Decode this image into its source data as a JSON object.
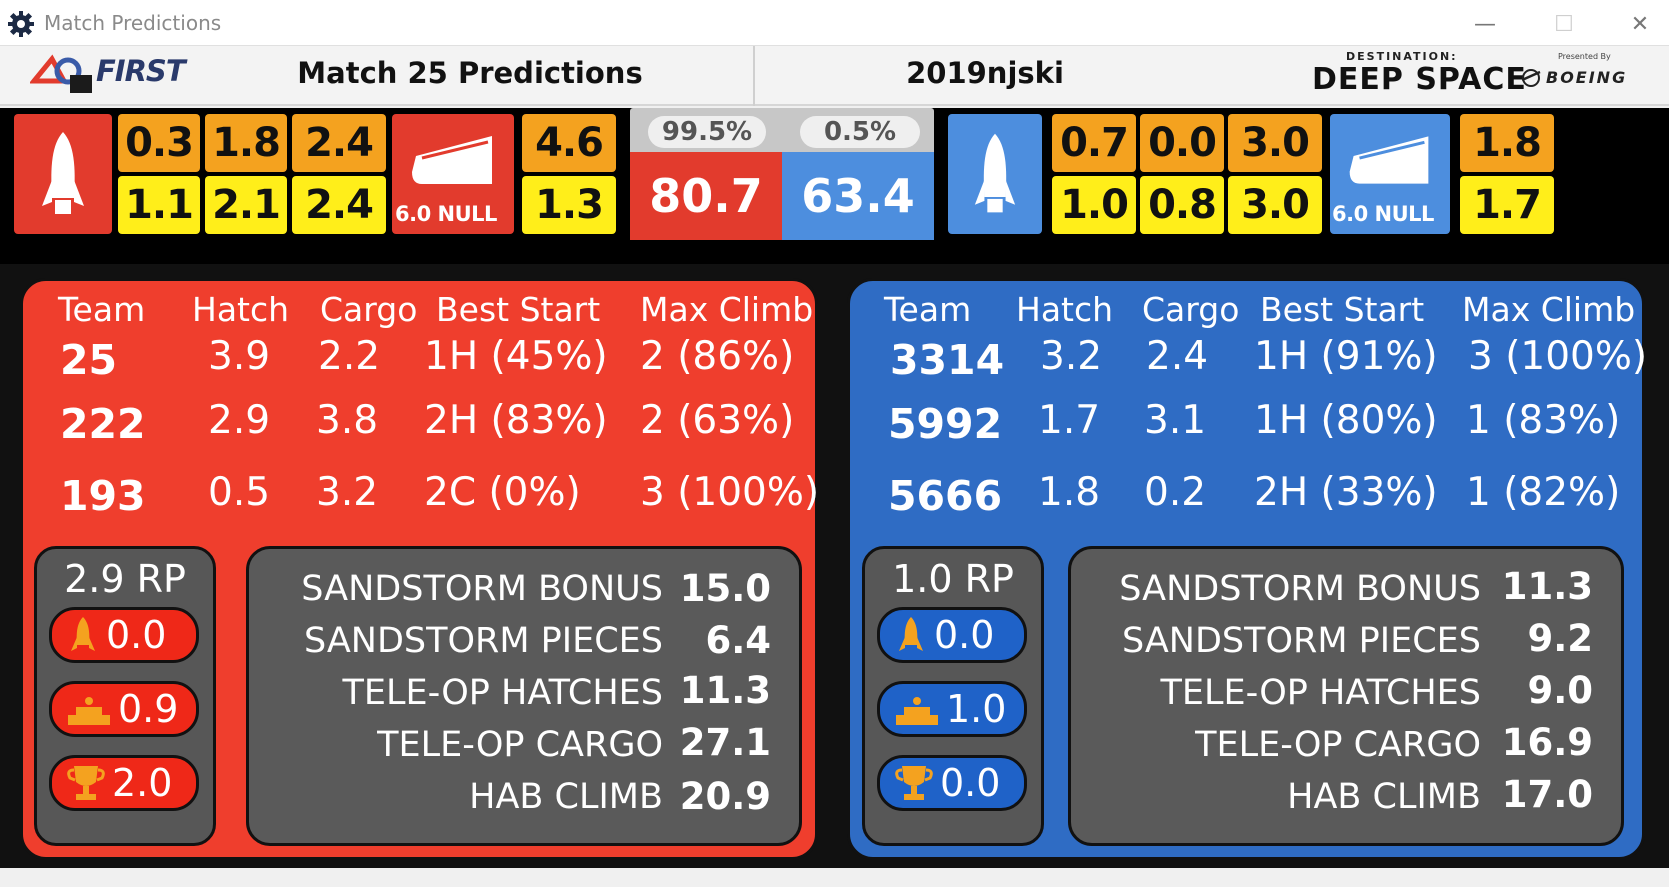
{
  "window": {
    "title": "Match Predictions"
  },
  "header": {
    "first_logo": "FIRST",
    "match_title": "Match 25 Predictions",
    "event_code": "2019njski",
    "game_logo_top": "DESTINATION:",
    "game_logo_main": "DEEP SPACE",
    "sponsor_small": "Presented By",
    "sponsor": "BOEING"
  },
  "strip": {
    "red": {
      "rocket_top": [
        "0.3",
        "1.8",
        "2.4"
      ],
      "rocket_bottom": [
        "1.1",
        "2.1",
        "2.4"
      ],
      "cargoship_label": "6.0 NULL",
      "cargoship_top": "4.6",
      "cargoship_bottom": "1.3"
    },
    "blue": {
      "rocket_top": [
        "0.7",
        "0.0",
        "3.0"
      ],
      "rocket_bottom": [
        "1.0",
        "0.8",
        "3.0"
      ],
      "cargoship_label": "6.0 NULL",
      "cargoship_top": "1.8",
      "cargoship_bottom": "1.7"
    },
    "win_prob": {
      "red": "99.5%",
      "blue": "0.5%"
    },
    "score": {
      "red": "80.7",
      "blue": "63.4"
    }
  },
  "table_headers": [
    "Team",
    "Hatch",
    "Cargo",
    "Best Start",
    "Max Climb"
  ],
  "red": {
    "teams": [
      {
        "team": "25",
        "hatch": "3.9",
        "cargo": "2.2",
        "start": "1H (45%)",
        "climb": "2 (86%)"
      },
      {
        "team": "222",
        "hatch": "2.9",
        "cargo": "3.8",
        "start": "2H (83%)",
        "climb": "2 (63%)"
      },
      {
        "team": "193",
        "hatch": "0.5",
        "cargo": "3.2",
        "start": "2C (0%)",
        "climb": "3 (100%)"
      }
    ],
    "rp_title": "2.9 RP",
    "rp": {
      "rocket": "0.0",
      "hab": "0.9",
      "win": "2.0"
    },
    "breakdown": [
      {
        "label": "SANDSTORM BONUS",
        "value": "15.0"
      },
      {
        "label": "SANDSTORM PIECES",
        "value": "6.4"
      },
      {
        "label": "TELE-OP HATCHES",
        "value": "11.3"
      },
      {
        "label": "TELE-OP CARGO",
        "value": "27.1"
      },
      {
        "label": "HAB CLIMB",
        "value": "20.9"
      }
    ]
  },
  "blue": {
    "teams": [
      {
        "team": "3314",
        "hatch": "3.2",
        "cargo": "2.4",
        "start": "1H (91%)",
        "climb": "3 (100%)"
      },
      {
        "team": "5992",
        "hatch": "1.7",
        "cargo": "3.1",
        "start": "1H (80%)",
        "climb": "1 (83%)"
      },
      {
        "team": "5666",
        "hatch": "1.8",
        "cargo": "0.2",
        "start": "2H (33%)",
        "climb": "1 (82%)"
      }
    ],
    "rp_title": "1.0 RP",
    "rp": {
      "rocket": "0.0",
      "hab": "1.0",
      "win": "0.0"
    },
    "breakdown": [
      {
        "label": "SANDSTORM BONUS",
        "value": "11.3"
      },
      {
        "label": "SANDSTORM PIECES",
        "value": "9.2"
      },
      {
        "label": "TELE-OP HATCHES",
        "value": "9.0"
      },
      {
        "label": "TELE-OP CARGO",
        "value": "16.9"
      },
      {
        "label": "HAB CLIMB",
        "value": "17.0"
      }
    ]
  },
  "colors": {
    "red_alliance": "#ef3e2d",
    "blue_alliance": "#2f6cc4",
    "orange_tile": "#f4a21f",
    "yellow_tile": "#ffee1a",
    "rp_icon": "#f4a21f"
  }
}
